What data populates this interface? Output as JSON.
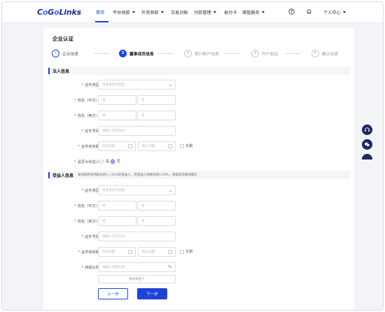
{
  "brand": {
    "logo": "CoGoLinks"
  },
  "nav": {
    "items": [
      {
        "label": "首页",
        "active": true,
        "dropdown": false
      },
      {
        "label": "平台收款",
        "dropdown": true
      },
      {
        "label": "外贸收款",
        "dropdown": true
      },
      {
        "label": "交易对账",
        "dropdown": false
      },
      {
        "label": "付款管理",
        "dropdown": true
      },
      {
        "label": "易付卡",
        "dropdown": false
      },
      {
        "label": "增值服务",
        "dropdown": true
      }
    ],
    "user_menu": "个人中心"
  },
  "page": {
    "title": "企业认证"
  },
  "steps": [
    {
      "num": "✓",
      "label": "企业信息",
      "state": "done"
    },
    {
      "num": "2",
      "label": "董事成员信息",
      "state": "current"
    },
    {
      "num": "3",
      "label": "银行账户信息",
      "state": "todo"
    },
    {
      "num": "4",
      "label": "开户验证",
      "state": "todo"
    },
    {
      "num": "5",
      "label": "确认信息",
      "state": "todo"
    }
  ],
  "legal": {
    "section_title": "法人信息",
    "id_type_label": "证件类型",
    "id_type_placeholder": "请选择证件类型",
    "name_cn_label": "姓名（中文）",
    "name_en_label": "姓名（英文）",
    "surname_placeholder": "姓",
    "given_placeholder": "名",
    "id_no_label": "证件号码",
    "id_no_placeholder": "请输入证件号码",
    "validity_label": "证件有效期",
    "start_placeholder": "开始日期",
    "end_placeholder": "截止日期",
    "long_term": "长期",
    "is_beneficiary_label": "是否为受益人",
    "yes": "是",
    "no": "否",
    "is_beneficiary_selected": "否"
  },
  "beneficiary": {
    "section_title": "受益人信息",
    "note": "请添加所有持股比例>=25%的受益人，若受益人持股比例<25%，请按实际情况填写",
    "id_type_label": "证件类型",
    "id_type_placeholder": "请选择证件类型",
    "name_cn_label": "姓名（中文）",
    "name_en_label": "姓名（英文）",
    "surname_placeholder": "姓",
    "given_placeholder": "名",
    "id_no_label": "证件号码",
    "id_no_placeholder": "请输入证件号码",
    "validity_label": "证件有效期",
    "start_placeholder": "开始日期",
    "end_placeholder": "截止日期",
    "long_term": "长期",
    "ratio_label": "持股比例",
    "ratio_placeholder": "请输入持股比例",
    "ratio_unit": "%",
    "add_button": "添加受益人"
  },
  "actions": {
    "prev": "上一步",
    "next": "下一步"
  },
  "colors": {
    "primary": "#1d44d6",
    "brand_dark": "#1c2f8a",
    "float_bg": "#1b2a5e",
    "required": "#e23b3b"
  }
}
